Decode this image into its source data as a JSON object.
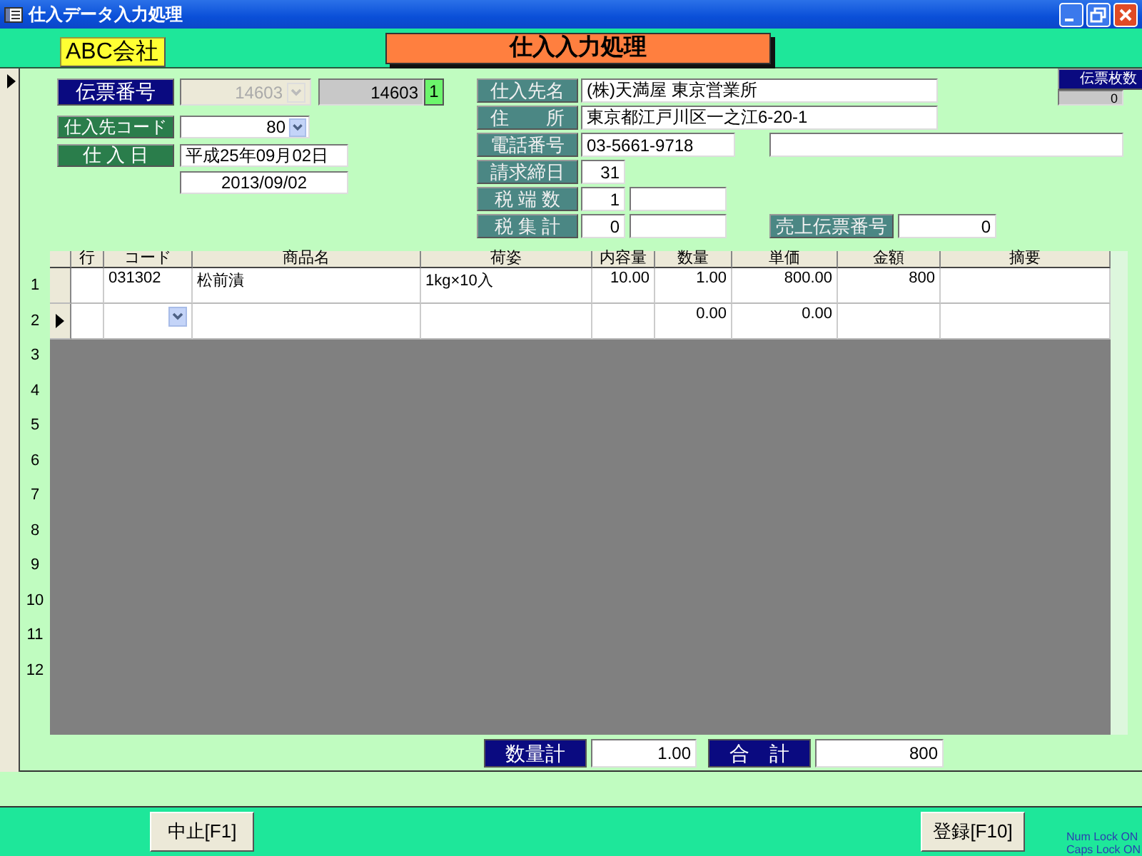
{
  "window": {
    "title": "仕入データ入力処理"
  },
  "header": {
    "company": "ABC会社",
    "form_title": "仕入入力処理"
  },
  "slip": {
    "label": "伝票番号",
    "combo_value": "14603",
    "disabled": true,
    "number": "14603",
    "badge": "1"
  },
  "supplier_code": {
    "label": "仕入先コード",
    "value": "80"
  },
  "purchase_date": {
    "label": "仕 入 日",
    "wareki": "平成25年09月02日",
    "date": "2013/09/02"
  },
  "slip_count": {
    "label": "伝票枚数",
    "value": "0"
  },
  "supplier_fields": [
    {
      "kind": "long",
      "label": "仕入先名",
      "value": "(株)天満屋 東京営業所"
    },
    {
      "kind": "long",
      "label": "住　　所",
      "value": "東京都江戸川区一之江6-20-1"
    },
    {
      "kind": "phone",
      "label": "電話番号",
      "value": "03-5661-9718"
    },
    {
      "kind": "short",
      "label": "請求締日",
      "value": "31"
    },
    {
      "kind": "pair",
      "label": "税 端 数",
      "value": "1"
    },
    {
      "kind": "pair",
      "label": "税 集 計",
      "value": "0",
      "side_label": "売上伝票番号",
      "side_value": "0"
    }
  ],
  "grid": {
    "columns": [
      "行",
      "コード",
      "商品名",
      "荷姿",
      "内容量",
      "数量",
      "単価",
      "金額",
      "摘要"
    ],
    "rows": [
      {
        "current": false,
        "cells": [
          null,
          "031302",
          "松前漬",
          "1kg×10入",
          "10.00",
          "1.00",
          "800.00",
          "800",
          null
        ]
      },
      {
        "current": true,
        "cells": [
          null,
          null,
          null,
          null,
          null,
          "0.00",
          "0.00",
          null,
          null
        ]
      }
    ],
    "row_numbers": [
      "1",
      "2",
      "3",
      "4",
      "5",
      "6",
      "7",
      "8",
      "9",
      "10",
      "11",
      "12"
    ]
  },
  "totals": [
    {
      "label": "数量計",
      "value": "1.00"
    },
    {
      "label": "合　計",
      "value": "800"
    }
  ],
  "footer": {
    "cancel": "中止[F1]",
    "register": "登録[F10]",
    "status": [
      "Num Lock ON",
      "Caps Lock ON"
    ]
  }
}
